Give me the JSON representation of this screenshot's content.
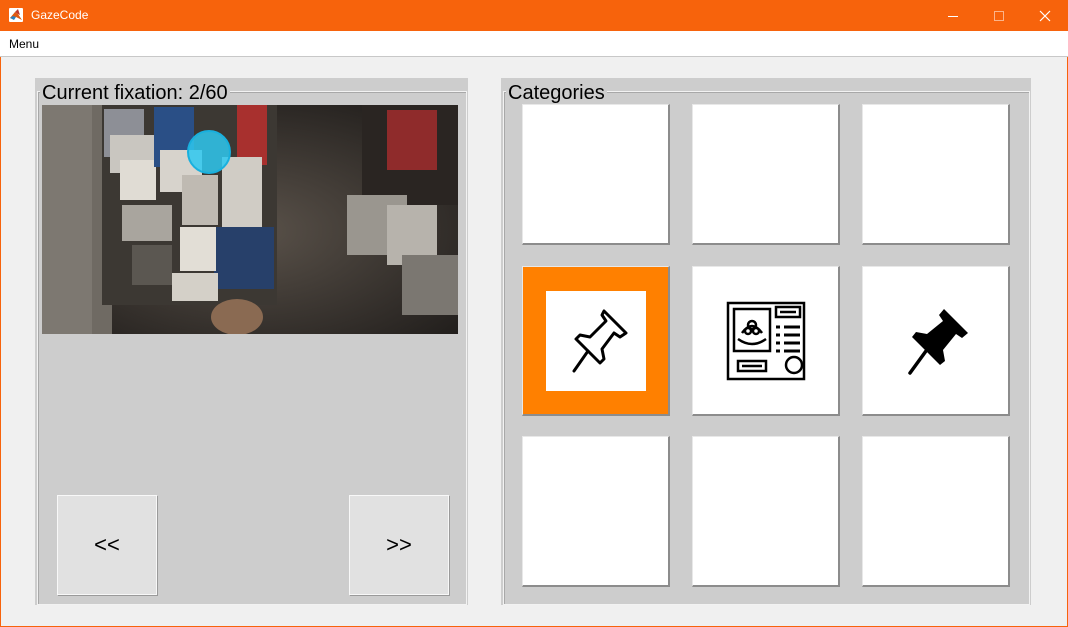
{
  "window": {
    "title": "GazeCode"
  },
  "menubar": {
    "menu_label": "Menu"
  },
  "fixation_panel": {
    "title": "Current fixation: 2/60",
    "prev_label": "<<",
    "next_label": ">>"
  },
  "categories_panel": {
    "title": "Categories",
    "tiles": [
      {
        "icon": "",
        "selected": false
      },
      {
        "icon": "",
        "selected": false
      },
      {
        "icon": "",
        "selected": false
      },
      {
        "icon": "pushpin-outline-icon",
        "selected": true
      },
      {
        "icon": "poster-menu-icon",
        "selected": false
      },
      {
        "icon": "pushpin-filled-icon",
        "selected": false
      },
      {
        "icon": "",
        "selected": false
      },
      {
        "icon": "",
        "selected": false
      },
      {
        "icon": "",
        "selected": false
      }
    ]
  },
  "colors": {
    "titlebar": "#f7630c",
    "selected_tile": "#ff8000",
    "fixation_marker": "#2ec8f0"
  }
}
